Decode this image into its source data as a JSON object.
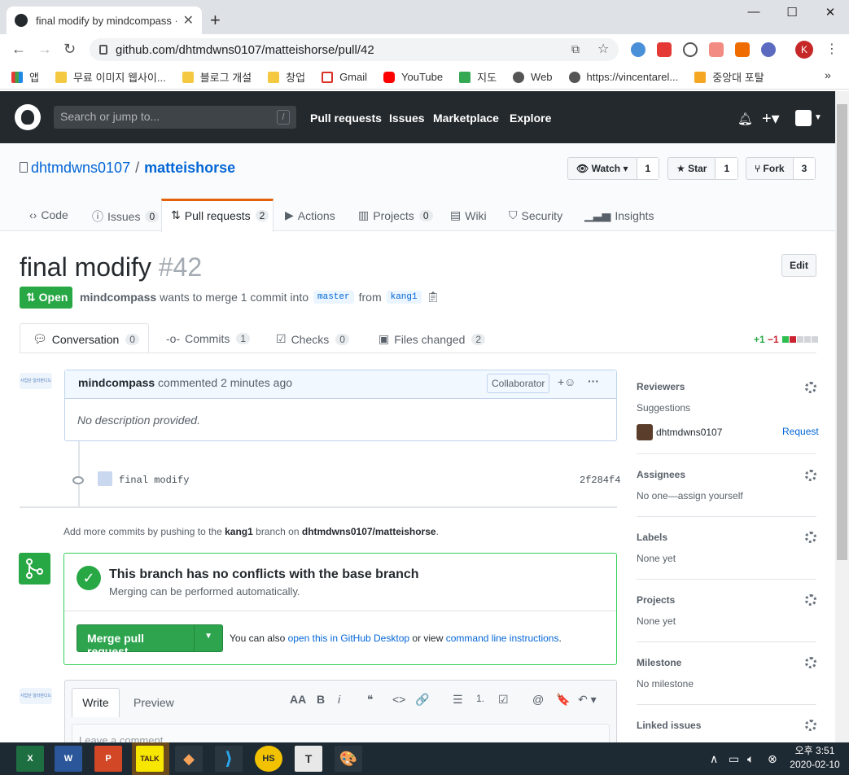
{
  "browser": {
    "tab_title": "final modify by mindcompass · P",
    "tab_close": "✕",
    "new_tab": "+",
    "url": "github.com/dhtmdwns0107/matteishorse/pull/42",
    "profile_initial": "K",
    "window_min": "—",
    "window_max": "☐",
    "window_close": "✕",
    "bookmarks": [
      "앱",
      "무료 이미지 웹사이...",
      "블로그 개설",
      "창업",
      "Gmail",
      "YouTube",
      "지도",
      "Web",
      "https://vincentarel...",
      "중앙대 포탈"
    ],
    "bookmarks_more": "»"
  },
  "github": {
    "search_placeholder": "Search or jump to...",
    "search_key": "/",
    "nav": [
      "Pull requests",
      "Issues",
      "Marketplace",
      "Explore"
    ]
  },
  "repo": {
    "owner": "dhtmdwns0107",
    "separator": "/",
    "name": "matteishorse",
    "watch_label": "Watch ▾",
    "watch_count": "1",
    "star_label": "Star",
    "star_count": "1",
    "fork_label": "Fork",
    "fork_count": "3",
    "tabs": [
      {
        "label": "Code",
        "count": ""
      },
      {
        "label": "Issues",
        "count": "0"
      },
      {
        "label": "Pull requests",
        "count": "2"
      },
      {
        "label": "Actions",
        "count": ""
      },
      {
        "label": "Projects",
        "count": "0"
      },
      {
        "label": "Wiki",
        "count": ""
      },
      {
        "label": "Security",
        "count": ""
      },
      {
        "label": "Insights",
        "count": ""
      }
    ]
  },
  "pr": {
    "title": "final modify",
    "number": "#42",
    "edit_label": "Edit",
    "state": "Open",
    "author": "mindcompass",
    "merge_text": "wants to merge 1 commit into",
    "base_branch": "master",
    "from_text": "from",
    "head_branch": "kang1",
    "tabs": [
      {
        "label": "Conversation",
        "count": "0"
      },
      {
        "label": "Commits",
        "count": "1"
      },
      {
        "label": "Checks",
        "count": "0"
      },
      {
        "label": "Files changed",
        "count": "2"
      }
    ],
    "additions": "+1",
    "deletions": "−1"
  },
  "comment": {
    "author": "mindcompass",
    "action": "commented 2 minutes ago",
    "badge": "Collaborator",
    "reaction": "+☺",
    "more": "···",
    "body": "No description provided.",
    "avatar_text": "사업단 일러펀디드"
  },
  "commit": {
    "message": "final modify",
    "sha": "2f284f4"
  },
  "push_hint": {
    "prefix": "Add more commits by pushing to the",
    "branch": "kang1",
    "middle": "branch on",
    "repo": "dhtmdwns0107/matteishorse",
    "suffix": "."
  },
  "merge": {
    "check_mark": "✓",
    "title": "This branch has no conflicts with the base branch",
    "subtitle": "Merging can be performed automatically.",
    "button_label": "Merge pull request",
    "button_caret": "▼",
    "alt_prefix": "You can also",
    "alt_link1": "open this in GitHub Desktop",
    "alt_middle": "or view",
    "alt_link2": "command line instructions",
    "alt_suffix": "."
  },
  "editor": {
    "write_tab": "Write",
    "preview_tab": "Preview",
    "placeholder": "Leave a comment",
    "tools": [
      "AA",
      "B",
      "i",
      "❝",
      "<>",
      "🔗",
      "☰",
      "1.",
      "☑",
      "@",
      "🔖",
      "↶ ▾"
    ]
  },
  "sidebar": {
    "reviewers": {
      "heading": "Reviewers",
      "suggestions": "Suggestions",
      "user": "dhtmdwns0107",
      "request": "Request"
    },
    "assignees": {
      "heading": "Assignees",
      "value": "No one—assign yourself"
    },
    "labels": {
      "heading": "Labels",
      "value": "None yet"
    },
    "projects": {
      "heading": "Projects",
      "value": "None yet"
    },
    "milestone": {
      "heading": "Milestone",
      "value": "No milestone"
    },
    "linked": {
      "heading": "Linked issues"
    }
  },
  "taskbar": {
    "apps": [
      "X",
      "W",
      "P",
      "TALK",
      "◆",
      "⟩",
      "HS",
      "T",
      "🎨"
    ],
    "time": "오후 3:51",
    "date": "2020-02-10",
    "tray_caret": "∧"
  },
  "colors": {
    "github_dark": "#24292e",
    "link": "#0366d6",
    "success": "#28a745",
    "active_tab_border": "#e36209"
  }
}
